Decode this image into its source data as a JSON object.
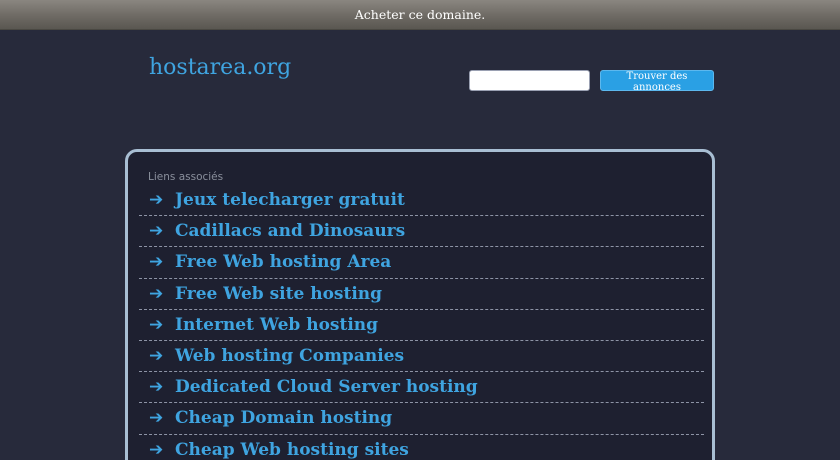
{
  "topbar": {
    "label": "Acheter ce domaine."
  },
  "header": {
    "logo": "hostarea.org",
    "search": {
      "value": "",
      "placeholder": "",
      "button_label": "Trouver des annonces"
    }
  },
  "related": {
    "title": "Liens associés",
    "items": [
      {
        "label": "Jeux telecharger gratuit"
      },
      {
        "label": "Cadillacs and Dinosaurs"
      },
      {
        "label": "Free Web hosting Area"
      },
      {
        "label": "Free Web site hosting"
      },
      {
        "label": "Internet Web hosting"
      },
      {
        "label": "Web hosting Companies"
      },
      {
        "label": "Dedicated Cloud Server hosting"
      },
      {
        "label": "Cheap Domain hosting"
      },
      {
        "label": "Cheap Web hosting sites"
      }
    ]
  },
  "icons": {
    "link_arrow": "arrow-right-icon"
  },
  "colors": {
    "background": "#272a3b",
    "panel_background": "#1e2030",
    "panel_border": "#a8bed3",
    "link": "#3fa4e0",
    "button": "#2aa0e4",
    "topbar": "#6e6a64"
  }
}
